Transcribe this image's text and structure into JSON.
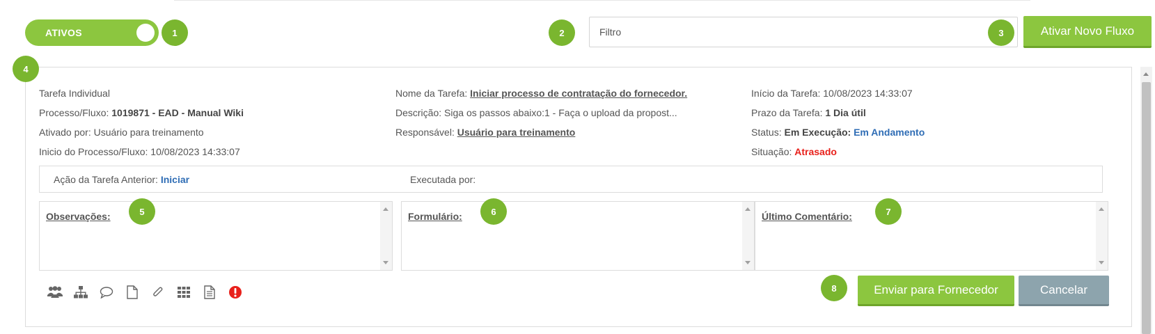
{
  "toggle": {
    "label": "ATIVOS",
    "on": true
  },
  "badges": [
    "1",
    "2",
    "3",
    "4",
    "5",
    "6",
    "7",
    "8"
  ],
  "filter": {
    "placeholder": "Filtro",
    "value": ""
  },
  "buttons": {
    "new_flow": "Ativar Novo Fluxo",
    "send": "Enviar para Fornecedor",
    "cancel": "Cancelar"
  },
  "task": {
    "type": "Tarefa Individual",
    "process_label": "Processo/Fluxo:",
    "process_value": "1019871 - EAD - Manual Wiki",
    "activated_by_label": "Ativado por:",
    "activated_by_value": "Usuário para treinamento",
    "process_start_label": "Inicio do Processo/Fluxo:",
    "process_start_value": "10/08/2023 14:33:07",
    "name_label": "Nome da Tarefa:",
    "name_value": "Iniciar processo de contratação do fornecedor.",
    "description_label": "Descrição:",
    "description_value": "Siga os passos abaixo:1 - Faça o upload da propost...",
    "responsible_label": "Responsável:",
    "responsible_value": "Usuário para treinamento",
    "task_start_label": "Início da Tarefa:",
    "task_start_value": "10/08/2023 14:33:07",
    "deadline_label": "Prazo da Tarefa:",
    "deadline_value": "1 Dia útil",
    "status_label": "Status:",
    "status_value": "Em Execução:",
    "status_detail": "Em Andamento",
    "situation_label": "Situação:",
    "situation_value": "Atrasado"
  },
  "previous_action": {
    "label": "Ação da Tarefa Anterior:",
    "value": "Iniciar",
    "executed_by_label": "Executada por:"
  },
  "panels": {
    "observations": "Observações:",
    "form": "Formulário:",
    "last_comment": "Último Comentário:"
  },
  "toolbar_icons": [
    "users-icon",
    "hierarchy-icon",
    "comment-icon",
    "document-icon",
    "paperclip-icon",
    "grid-icon",
    "file-text-icon",
    "alert-icon"
  ],
  "colors": {
    "green": "#8cc63f",
    "badge_green": "#7ab62f",
    "grey_button": "#8da4ad",
    "blue_text": "#2f6db5",
    "red_text": "#e8201b"
  }
}
